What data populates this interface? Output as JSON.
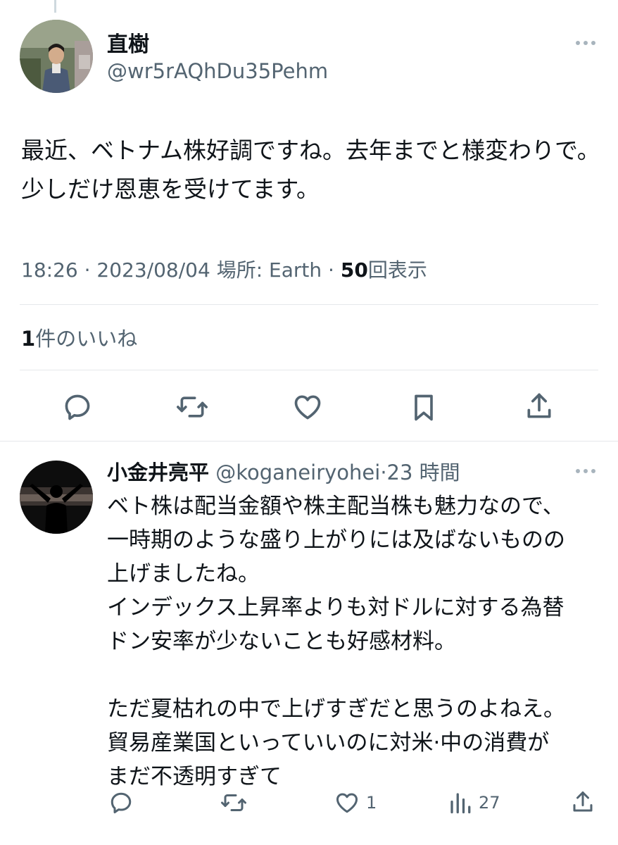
{
  "tweet": {
    "author_name": "直樹",
    "author_handle": "@wr5rAQhDu35Pehm",
    "text": "最近、ベトナム株好調ですね。去年までと様変わりで。少しだけ恩恵を受けてます。",
    "time": "18:26",
    "date": "2023/08/04",
    "location_label": "場所: Earth",
    "view_count": "50",
    "view_label": "回表示",
    "like_count": "1",
    "like_label": "件のいいね",
    "separator": "·"
  },
  "actions": {
    "icons": [
      "reply-icon",
      "retweet-icon",
      "like-icon",
      "bookmark-icon",
      "share-icon"
    ]
  },
  "reply": {
    "author_name": "小金井亮平",
    "author_handle": "@koganeiryohei",
    "separator": "·",
    "time": "23 時間",
    "text": "ベト株は配当金額や株主配当株も魅力なので、\n一時期のような盛り上がりには及ばないものの\n上げましたね。\nインデックス上昇率よりも対ドルに対する為替\nドン安率が少ないことも好感材料。\n\nただ夏枯れの中で上げすぎだと思うのよねえ。\n貿易産業国といっていいのに対米·中の消費が\nまだ不透明すぎて",
    "like_count": "1",
    "view_count": "27"
  },
  "colors": {
    "text_primary": "#0f1419",
    "text_secondary": "#536471",
    "divider": "#e5e8eb",
    "icon": "#536471"
  }
}
